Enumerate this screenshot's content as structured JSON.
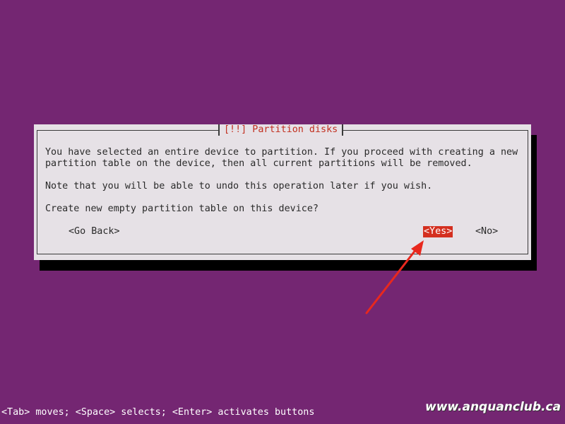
{
  "dialog": {
    "title": "[!!] Partition disks",
    "line1": "You have selected an entire device to partition. If you proceed with creating a new",
    "line2": "partition table on the device, then all current partitions will be removed.",
    "line3": "Note that you will be able to undo this operation later if you wish.",
    "question": "Create new empty partition table on this device?",
    "buttons": {
      "back": "<Go Back>",
      "yes": "<Yes>",
      "no": "<No>"
    }
  },
  "status_bar": {
    "text": "<Tab> moves; <Space> selects; <Enter> activates buttons"
  },
  "watermark": {
    "text": "www.anquanclub.ca"
  },
  "colors": {
    "background": "#742672",
    "dialog_bg": "#e6e1e6",
    "title": "#c22f1f",
    "selected_button": "#d42f1f",
    "arrow": "#e8281e"
  }
}
